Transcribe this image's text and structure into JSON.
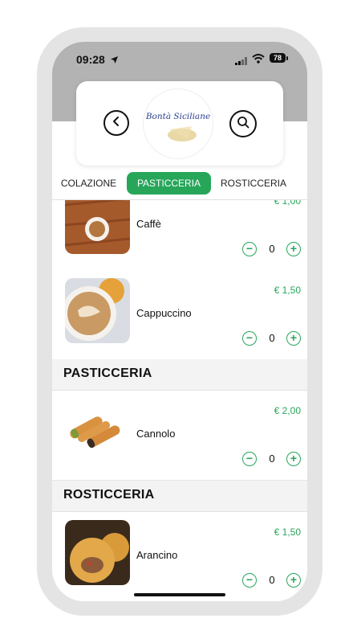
{
  "status_bar": {
    "time": "09:28",
    "battery": "78"
  },
  "header": {
    "logo_text": "Bontà Siciliane"
  },
  "tabs": [
    {
      "label": "COLAZIONE",
      "active": false
    },
    {
      "label": "PASTICCERIA",
      "active": true
    },
    {
      "label": "ROSTICCERIA",
      "active": false
    }
  ],
  "colors": {
    "accent": "#27a65a",
    "header_band": "#b3b3b3"
  },
  "items": [
    {
      "name": "Caffè",
      "price": "€ 1,00",
      "qty": "0"
    },
    {
      "name": "Cappuccino",
      "price": "€ 1,50",
      "qty": "0"
    },
    {
      "name": "Cannolo",
      "price": "€ 2,00",
      "qty": "0"
    },
    {
      "name": "Arancino",
      "price": "€ 1,50",
      "qty": "0"
    }
  ],
  "sections": [
    {
      "title": "PASTICCERIA"
    },
    {
      "title": "ROSTICCERIA"
    }
  ],
  "controls": {
    "minus": "−",
    "plus": "+"
  }
}
